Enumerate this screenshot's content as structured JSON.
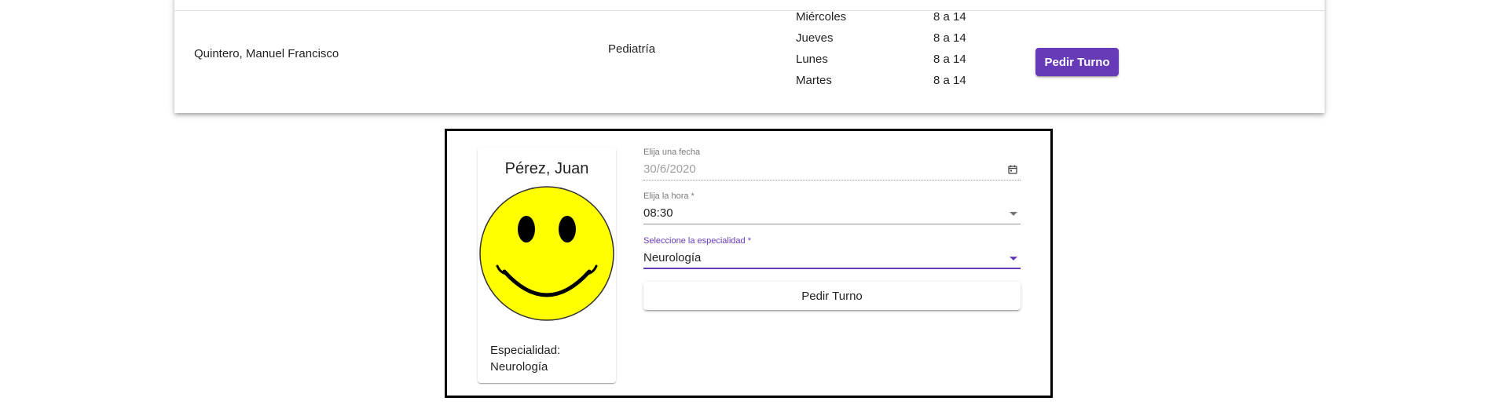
{
  "table": {
    "row": {
      "doctor": "Quintero, Manuel Francisco",
      "specialty": "Pediatría",
      "schedule": [
        {
          "day": "Miércoles",
          "hours": "8 a 14"
        },
        {
          "day": "Jueves",
          "hours": "8 a 14"
        },
        {
          "day": "Lunes",
          "hours": "8 a 14"
        },
        {
          "day": "Martes",
          "hours": "8 a 14"
        }
      ],
      "button_label": "Pedir Turno"
    }
  },
  "profile": {
    "name": "Pérez, Juan",
    "specialty_label": "Especialidad:",
    "specialty_value": "Neurología",
    "avatar_icon": "smiley-face-icon"
  },
  "form": {
    "date": {
      "label": "Elija una fecha",
      "value": "30/6/2020",
      "icon": "calendar-icon"
    },
    "time": {
      "label": "Elija la hora *",
      "value": "08:30"
    },
    "specialty": {
      "label": "Seleccione la especialidad *",
      "value": "Neurología"
    },
    "submit_label": "Pedir Turno"
  },
  "colors": {
    "primary": "#673ab7",
    "smiley_fill": "#ffff00"
  }
}
